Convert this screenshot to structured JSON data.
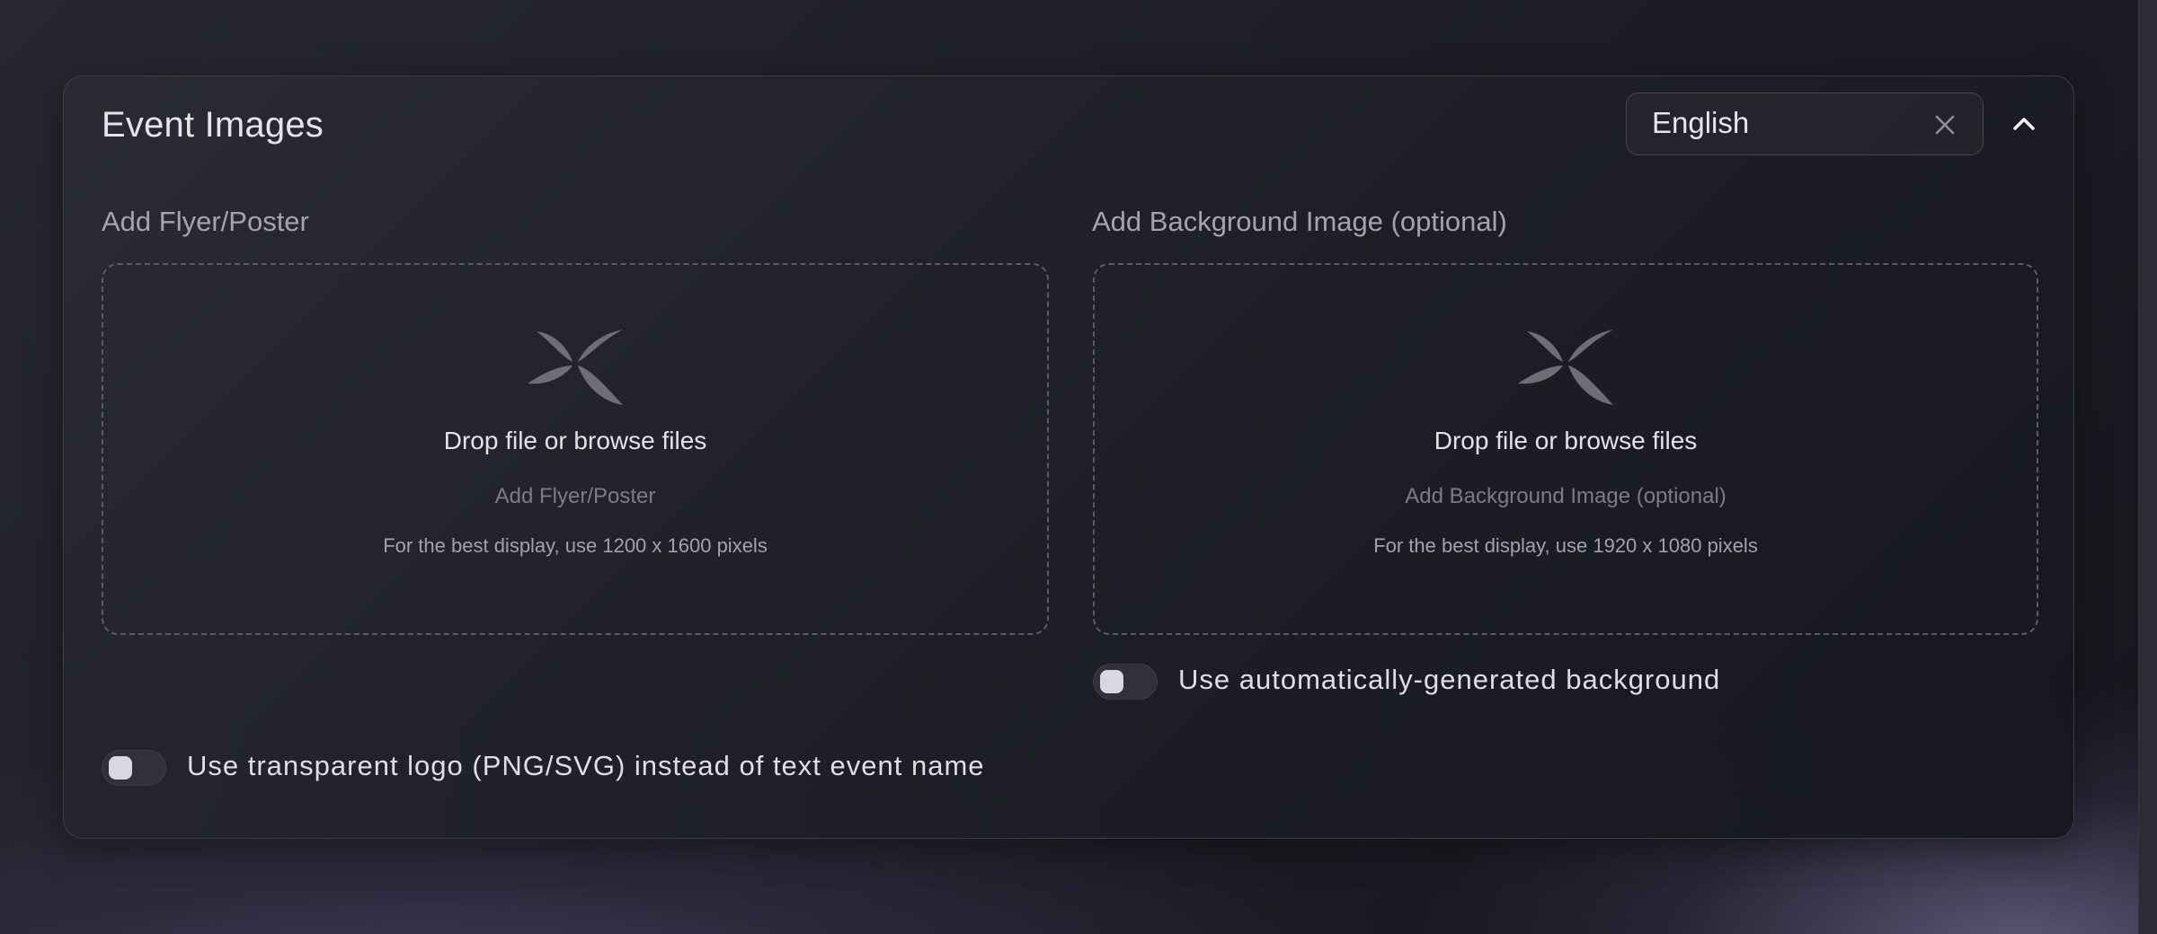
{
  "panel": {
    "title": "Event Images",
    "language": {
      "value": "English",
      "clear_icon": "close-icon"
    },
    "collapse_icon": "chevron-up-icon"
  },
  "flyer": {
    "label": "Add Flyer/Poster",
    "dropzone": {
      "icon": "butterfly-icon",
      "main_text": "Drop file or browse files",
      "sub_text": "Add Flyer/Poster",
      "hint": "For the best display, use 1200 x 1600 pixels"
    }
  },
  "background": {
    "label": "Add Background Image (optional)",
    "dropzone": {
      "icon": "butterfly-icon",
      "main_text": "Drop file or browse files",
      "sub_text": "Add Background Image (optional)",
      "hint": "For the best display, use 1920 x 1080 pixels"
    }
  },
  "toggles": {
    "auto_background": {
      "label": "Use automatically-generated background",
      "checked": false
    },
    "transparent_logo": {
      "label": "Use transparent logo (PNG/SVG) instead of text event name",
      "checked": false
    }
  }
}
